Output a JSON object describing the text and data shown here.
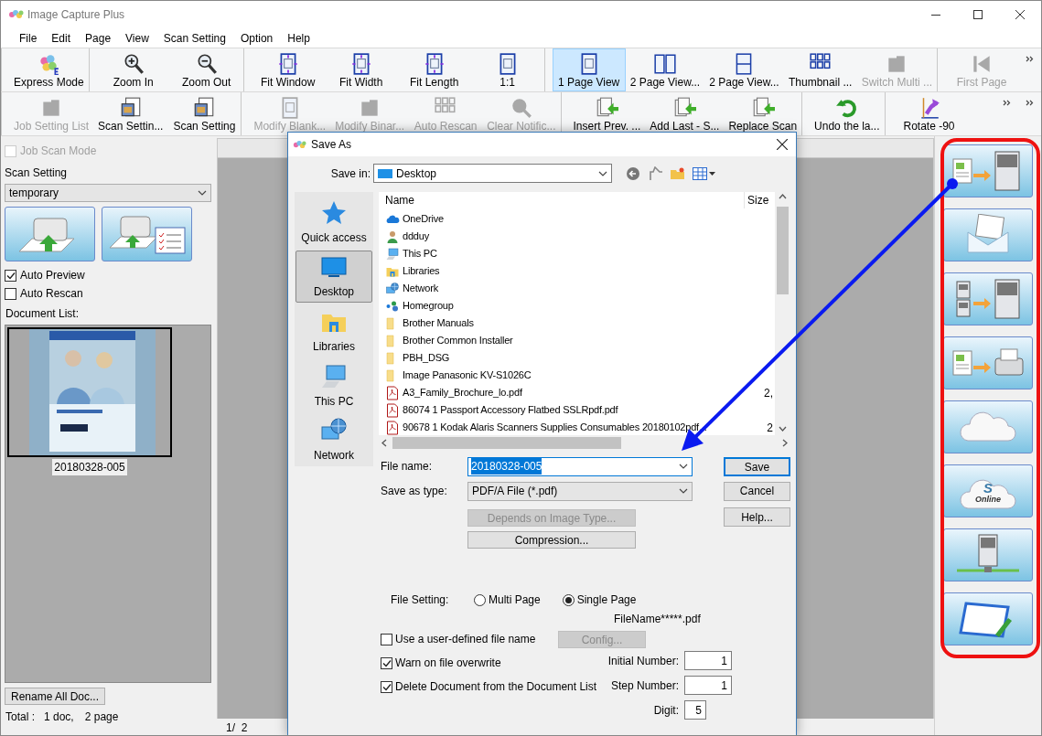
{
  "app": {
    "title": "Image Capture Plus"
  },
  "menu": [
    "File",
    "Edit",
    "Page",
    "View",
    "Scan Setting",
    "Option",
    "Help"
  ],
  "toolbar_rows": [
    {
      "groups": [
        {
          "items": [
            {
              "kind": "express",
              "label": "Express Mode",
              "disabled": false,
              "selected": false
            }
          ]
        },
        {
          "items": [
            {
              "kind": "zoom-in",
              "label": "Zoom In",
              "disabled": false,
              "selected": false
            },
            {
              "kind": "zoom-out",
              "label": "Zoom Out",
              "disabled": false,
              "selected": false
            }
          ]
        },
        {
          "items": [
            {
              "kind": "fit-window",
              "label": "Fit Window",
              "disabled": false,
              "selected": false
            },
            {
              "kind": "fit-width",
              "label": "Fit Width",
              "disabled": false,
              "selected": false
            },
            {
              "kind": "fit-length",
              "label": "Fit Length",
              "disabled": false,
              "selected": false
            },
            {
              "kind": "actual-size",
              "label": "1:1",
              "disabled": false,
              "selected": false
            }
          ]
        },
        {
          "items": [
            {
              "kind": "one-page",
              "label": "1 Page View",
              "disabled": false,
              "selected": true
            },
            {
              "kind": "two-page",
              "label": "2 Page View...",
              "disabled": false,
              "selected": false
            },
            {
              "kind": "two-page-stacked",
              "label": "2 Page View...",
              "disabled": false,
              "selected": false
            },
            {
              "kind": "thumbnail",
              "label": "Thumbnail ...",
              "disabled": false,
              "selected": false
            },
            {
              "kind": "switch",
              "label": "Switch Multi ...",
              "disabled": true,
              "selected": false
            }
          ]
        },
        {
          "items": [
            {
              "kind": "first-page",
              "label": "First Page",
              "disabled": true,
              "selected": false
            }
          ]
        }
      ]
    },
    {
      "groups": [
        {
          "items": [
            {
              "kind": "job-list",
              "label": "Job Setting List",
              "disabled": true,
              "selected": false
            },
            {
              "kind": "scan-settings",
              "label": "Scan Settin...",
              "disabled": false,
              "selected": false
            },
            {
              "kind": "scan-setting-edit",
              "label": "Scan Setting",
              "disabled": false,
              "selected": false
            }
          ]
        },
        {
          "items": [
            {
              "kind": "modify-blank",
              "label": "Modify Blank...",
              "disabled": true,
              "selected": false
            },
            {
              "kind": "modify-binary",
              "label": "Modify Binar...",
              "disabled": true,
              "selected": false
            },
            {
              "kind": "auto-rescan",
              "label": "Auto Rescan",
              "disabled": true,
              "selected": false
            },
            {
              "kind": "clear-notification",
              "label": "Clear Notific...",
              "disabled": true,
              "selected": false
            }
          ]
        },
        {
          "items": [
            {
              "kind": "insert-prev",
              "label": "Insert Prev. ...",
              "disabled": false,
              "selected": false
            },
            {
              "kind": "add-last",
              "label": "Add Last - S...",
              "disabled": false,
              "selected": false
            },
            {
              "kind": "replace",
              "label": "Replace Scan",
              "disabled": false,
              "selected": false
            }
          ]
        },
        {
          "items": [
            {
              "kind": "undo",
              "label": "Undo the la...",
              "disabled": false,
              "selected": false
            }
          ]
        },
        {
          "items": [
            {
              "kind": "rotate",
              "label": "Rotate -90",
              "disabled": false,
              "selected": false
            }
          ]
        }
      ]
    }
  ],
  "left_panel": {
    "job_scan_mode": {
      "label": "Job Scan Mode",
      "checked": false,
      "disabled": true
    },
    "scan_setting_label": "Scan Setting",
    "scan_setting_value": "temporary",
    "auto_preview": {
      "label": "Auto Preview",
      "checked": true
    },
    "auto_rescan": {
      "label": "Auto Rescan",
      "checked": false
    },
    "document_list_label": "Document List:",
    "documents": [
      {
        "name": "20180328-005",
        "selected": true
      }
    ],
    "rename_button": "Rename All Doc...",
    "total": {
      "label": "Total :",
      "docs": "1 doc,",
      "pages": "2 page"
    }
  },
  "viewer": {
    "page_indicator": "1/  2"
  },
  "save_dialog": {
    "title": "Save As",
    "save_in_label": "Save in:",
    "save_in_value": "Desktop",
    "places": [
      {
        "kind": "quick-access",
        "label": "Quick access",
        "selected": false
      },
      {
        "kind": "desktop",
        "label": "Desktop",
        "selected": true
      },
      {
        "kind": "libraries",
        "label": "Libraries",
        "selected": false
      },
      {
        "kind": "this-pc",
        "label": "This PC",
        "selected": false
      },
      {
        "kind": "network",
        "label": "Network",
        "selected": false
      }
    ],
    "columns": [
      "Name",
      "Size"
    ],
    "files": [
      {
        "kind": "onedrive",
        "name": "OneDrive"
      },
      {
        "kind": "user",
        "name": "ddduy"
      },
      {
        "kind": "this-pc",
        "name": "This PC"
      },
      {
        "kind": "libraries",
        "name": "Libraries"
      },
      {
        "kind": "network",
        "name": "Network"
      },
      {
        "kind": "homegroup",
        "name": "Homegroup"
      },
      {
        "kind": "folder",
        "name": "Brother Manuals"
      },
      {
        "kind": "folder",
        "name": "Brother Common Installer"
      },
      {
        "kind": "folder",
        "name": "PBH_DSG"
      },
      {
        "kind": "folder",
        "name": "Image Panasonic KV-S1026C"
      },
      {
        "kind": "pdf",
        "name": "A3_Family_Brochure_lo.pdf",
        "size": "2,"
      },
      {
        "kind": "pdf",
        "name": "86074 1  Passport Accessory Flatbed SSLRpdf.pdf"
      },
      {
        "kind": "pdf",
        "name": "90678 1  Kodak  Alaris Scanners Supplies  Consumables  20180102pdf...",
        "size": "2"
      }
    ],
    "file_name_label": "File name:",
    "file_name": "20180328-005",
    "save_as_type_label": "Save as type:",
    "save_as_type": "PDF/A File (*.pdf)",
    "save_button": "Save",
    "cancel_button": "Cancel",
    "help_button": "Help...",
    "depends_button": {
      "label": "Depends on Image Type...",
      "disabled": true
    },
    "compression_button": {
      "label": "Compression...",
      "disabled": false
    },
    "file_setting_label": "File Setting:",
    "file_setting_options": [
      {
        "label": "Multi Page",
        "selected": false
      },
      {
        "label": "Single Page",
        "selected": true
      }
    ],
    "file_pattern": "FileName*****.pdf",
    "options": [
      {
        "label": "Use a user-defined file name",
        "checked": false
      },
      {
        "label": "Warn on file overwrite",
        "checked": true
      },
      {
        "label": "Delete Document from the Document List",
        "checked": true
      }
    ],
    "config_button": {
      "label": "Config...",
      "disabled": true
    },
    "number_fields": [
      {
        "label": "Initial Number:",
        "value": "1"
      },
      {
        "label": "Step Number:",
        "value": "1"
      },
      {
        "label": "Digit:",
        "value": "5"
      }
    ]
  },
  "side_buttons": [
    {
      "kind": "document-to-server"
    },
    {
      "kind": "mail"
    },
    {
      "kind": "server-to-server"
    },
    {
      "kind": "document-to-printer"
    },
    {
      "kind": "cloud"
    },
    {
      "kind": "online-cloud",
      "badge": "S",
      "caption": "Online"
    },
    {
      "kind": "network-server"
    },
    {
      "kind": "edit-window"
    }
  ]
}
